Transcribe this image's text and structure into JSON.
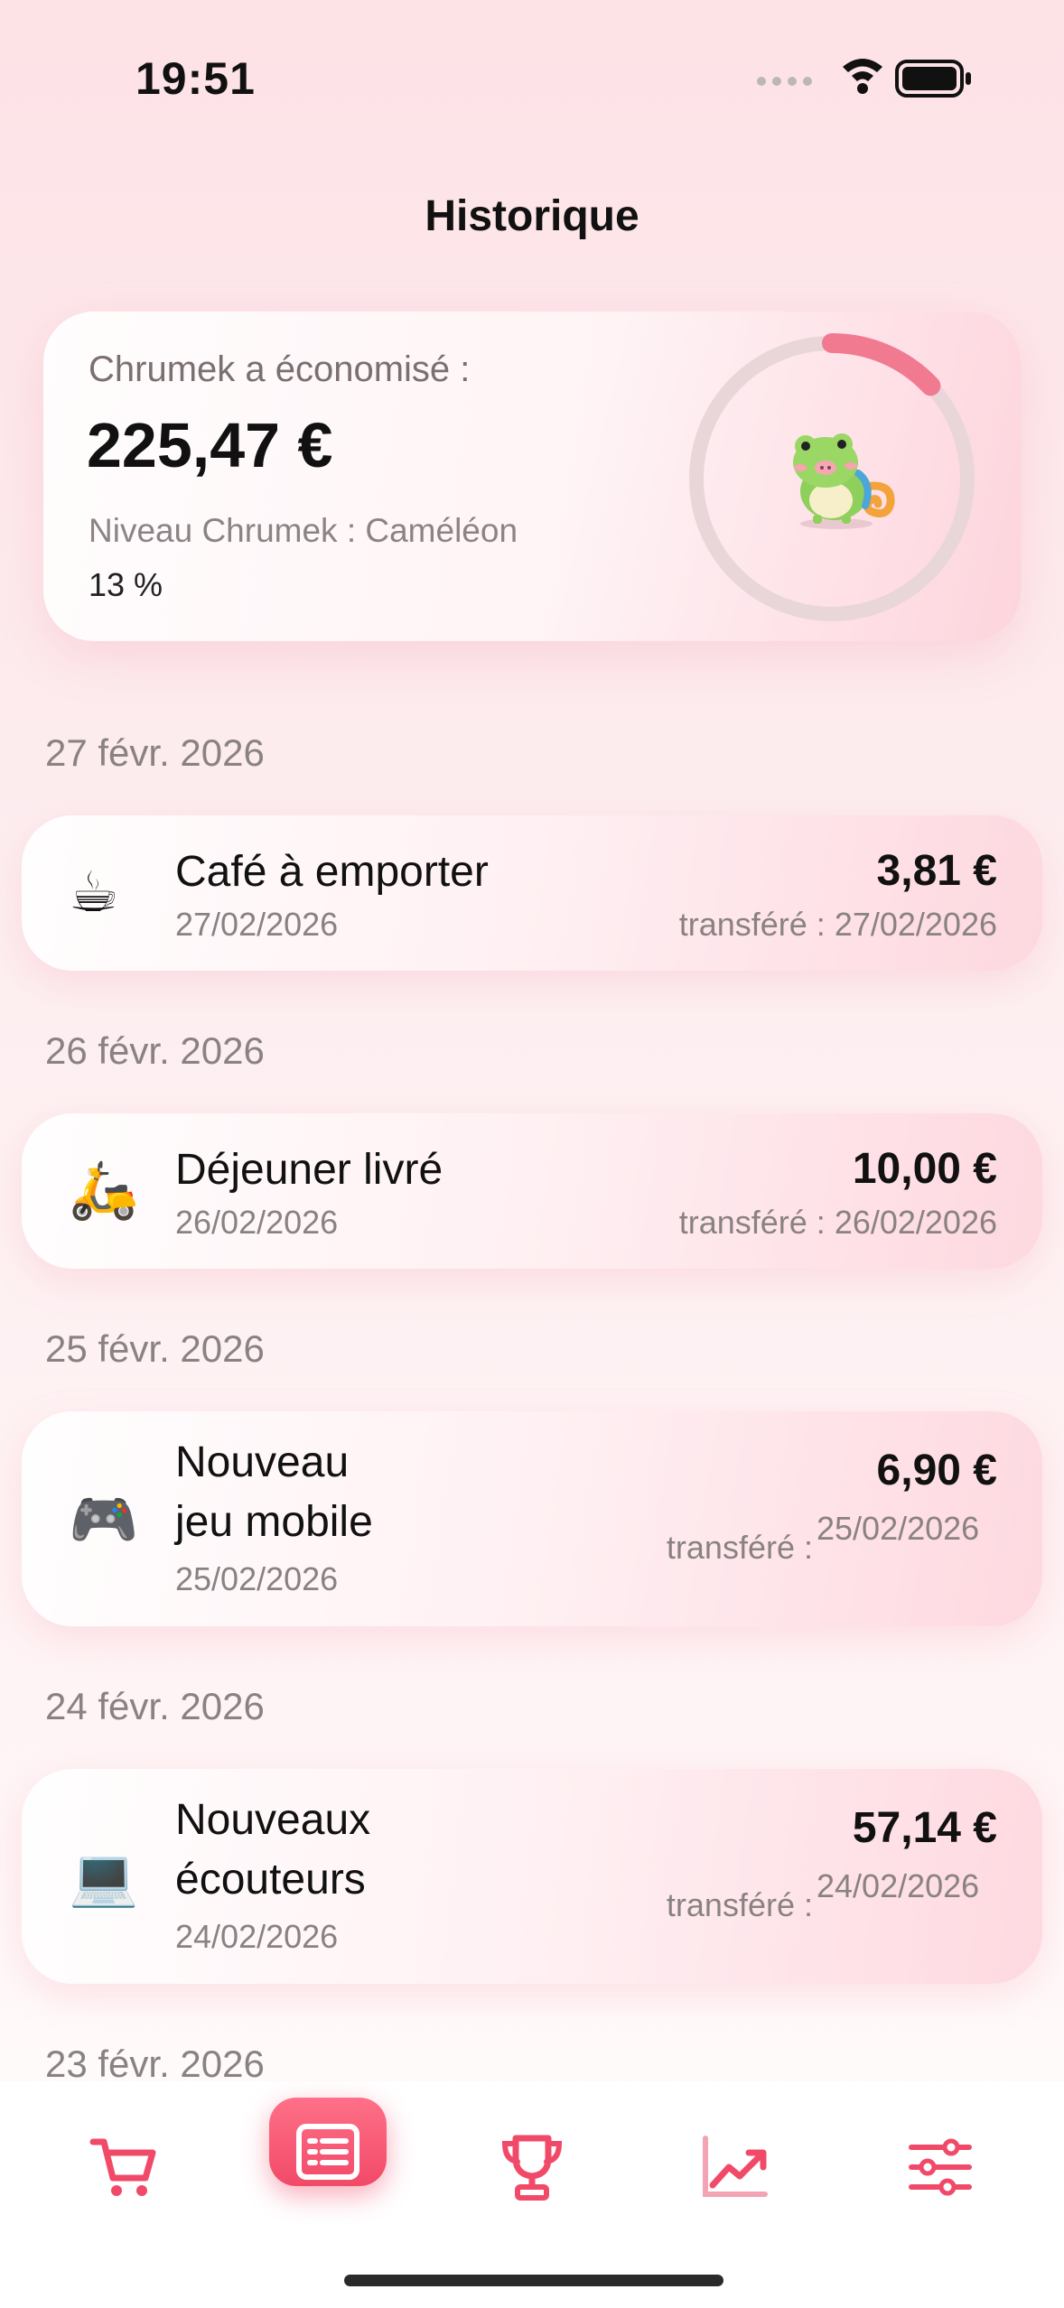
{
  "status_bar": {
    "time": "19:51"
  },
  "header": {
    "title": "Historique"
  },
  "summary": {
    "saved_label": "Chrumek a économisé :",
    "saved_amount": "225,47 €",
    "level_label": "Niveau Chrumek : Caméléon",
    "level_percent": "13 %",
    "progress_fraction": 0.13,
    "progress_color": "#f17a91"
  },
  "history": [
    {
      "date_header": "27 févr. 2026",
      "icon": "☕",
      "name": "Café à emporter",
      "date": "27/02/2026",
      "amount": "3,81 €",
      "transfer_label": "transféré :",
      "transfer_date": "27/02/2026"
    },
    {
      "date_header": "26 févr. 2026",
      "icon": "🛵",
      "name": "Déjeuner livré",
      "date": "26/02/2026",
      "amount": "10,00 €",
      "transfer_label": "transféré :",
      "transfer_date": "26/02/2026"
    },
    {
      "date_header": "25 févr. 2026",
      "icon": "🎮",
      "name_line1": "Nouveau",
      "name_line2": "jeu mobile",
      "date": "25/02/2026",
      "amount": "6,90 €",
      "transfer_label": "transféré :",
      "transfer_date": "25/02/2026"
    },
    {
      "date_header": "24 févr. 2026",
      "icon": "💻",
      "name_line1": "Nouveaux",
      "name_line2": "écouteurs",
      "date": "24/02/2026",
      "amount": "57,14 €",
      "transfer_label": "transféré :",
      "transfer_date": "24/02/2026"
    },
    {
      "date_header": "23 févr. 2026"
    }
  ],
  "tab_bar": {
    "active": "history",
    "accent": "#f14a68",
    "tabs": [
      "cart-icon",
      "history-list-icon",
      "trophy-icon",
      "chart-trend-icon",
      "settings-sliders-icon"
    ]
  }
}
